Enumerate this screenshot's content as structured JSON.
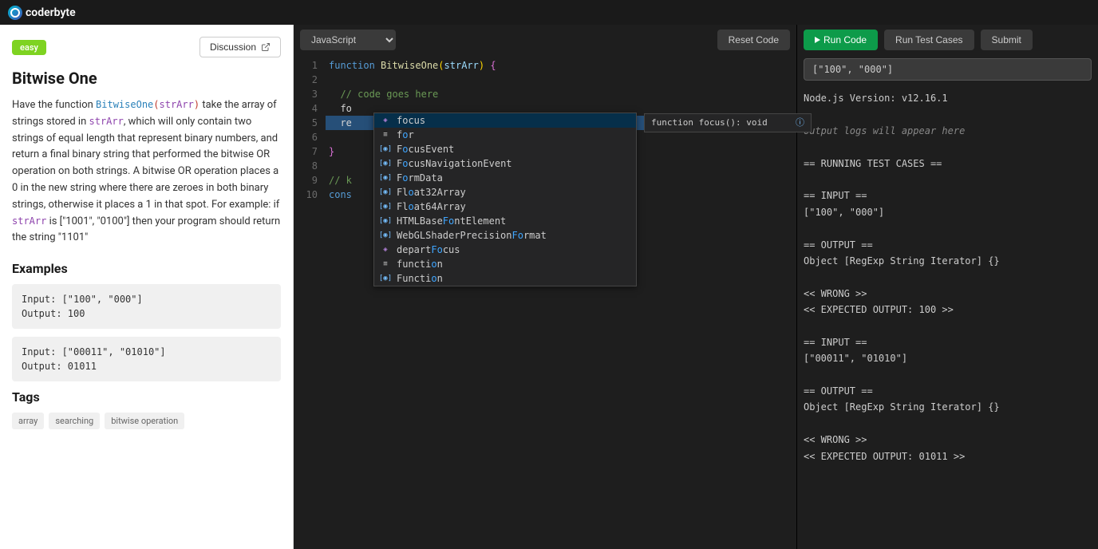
{
  "header": {
    "brand": "coderbyte"
  },
  "left": {
    "difficulty": "easy",
    "discussion_btn": "Discussion",
    "title": "Bitwise One",
    "desc": {
      "pre": "Have the function ",
      "fn": "BitwiseOne",
      "paren_open": "(",
      "arg": "strArr",
      "paren_close": ")",
      "mid1": " take the array of strings stored in ",
      "arg2": "strArr",
      "mid2": ", which will only contain two strings of equal length that represent binary numbers, and return a final binary string that performed the bitwise OR operation on both strings. A bitwise OR operation places a 0 in the new string where there are zeroes in both binary strings, otherwise it places a 1 in that spot. For example: if ",
      "arg3": "strArr",
      "mid3": " is [\"1001\", \"0100\"] then your program should return the string \"1101\""
    },
    "examples_title": "Examples",
    "example1": "Input: [\"100\", \"000\"]\nOutput: 100",
    "example2": "Input: [\"00011\", \"01010\"]\nOutput: 01011",
    "tags_title": "Tags",
    "tags": [
      "array",
      "searching",
      "bitwise operation"
    ]
  },
  "editor": {
    "language": "JavaScript",
    "reset_btn": "Reset Code",
    "run_btn": "Run Code",
    "run_tests_btn": "Run Test Cases",
    "submit_btn": "Submit",
    "lines": [
      "1",
      "2",
      "3",
      "4",
      "5",
      "6",
      "7",
      "8",
      "9",
      "10"
    ],
    "autocomplete": {
      "hint": "function focus(): void",
      "items": [
        {
          "kind": "method",
          "pre": "fo",
          "match": "",
          "post": "cus",
          "raw": "focus",
          "selected": true
        },
        {
          "kind": "keyword",
          "pre": "f",
          "match": "o",
          "post": "r",
          "raw": "for"
        },
        {
          "kind": "var",
          "pre": "F",
          "match": "o",
          "post": "cusEvent",
          "raw": "FocusEvent"
        },
        {
          "kind": "var",
          "pre": "F",
          "match": "o",
          "post": "cusNavigationEvent",
          "raw": "FocusNavigationEvent"
        },
        {
          "kind": "var",
          "pre": "F",
          "match": "o",
          "post": "rmData",
          "raw": "FormData"
        },
        {
          "kind": "var",
          "pre": "Fl",
          "match": "o",
          "post": "at32Array",
          "raw": "Float32Array"
        },
        {
          "kind": "var",
          "pre": "Fl",
          "match": "o",
          "post": "at64Array",
          "raw": "Float64Array"
        },
        {
          "kind": "var",
          "pre": "HTMLBase",
          "match": "Fo",
          "post": "ntElement",
          "raw": "HTMLBaseFontElement"
        },
        {
          "kind": "var",
          "pre": "WebGLShaderPrecision",
          "match": "Fo",
          "post": "rmat",
          "raw": "WebGLShaderPrecisionFormat"
        },
        {
          "kind": "method",
          "pre": "depart",
          "match": "Fo",
          "post": "cus",
          "raw": "departFocus"
        },
        {
          "kind": "keyword",
          "pre": "functi",
          "match": "o",
          "post": "n",
          "raw": "function"
        },
        {
          "kind": "var",
          "pre": "Functi",
          "match": "o",
          "post": "n",
          "raw": "Function"
        }
      ]
    }
  },
  "output": {
    "input_preview": "[\"100\", \"000\"]",
    "lines": [
      "Node.js Version: v12.16.1",
      "",
      "output logs will appear here",
      "",
      "== RUNNING TEST CASES ==",
      "",
      "== INPUT ==",
      "[\"100\", \"000\"]",
      "",
      "== OUTPUT ==",
      "Object [RegExp String Iterator] {}",
      "",
      "<< WRONG >>",
      "<< EXPECTED OUTPUT: 100 >>",
      "",
      "== INPUT ==",
      "[\"00011\", \"01010\"]",
      "",
      "== OUTPUT ==",
      "Object [RegExp String Iterator] {}",
      "",
      "<< WRONG >>",
      "<< EXPECTED OUTPUT: 01011 >>"
    ]
  }
}
